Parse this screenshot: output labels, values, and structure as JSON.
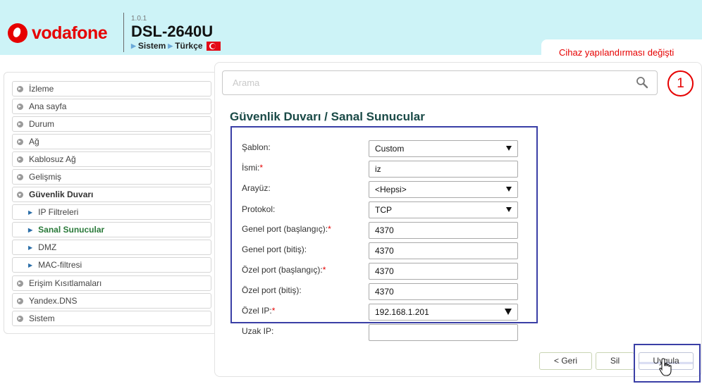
{
  "header": {
    "brand": "vodafone",
    "version": "1.0.1",
    "model": "DSL-2640U",
    "breadcrumb": [
      "Sistem",
      "Türkçe"
    ],
    "notice": "Cihaz yapılandırması değişti"
  },
  "search": {
    "placeholder": "Arama",
    "badge_count": "1"
  },
  "sidebar": {
    "items": [
      {
        "label": "İzleme"
      },
      {
        "label": "Ana sayfa"
      },
      {
        "label": "Durum"
      },
      {
        "label": "Ağ"
      },
      {
        "label": "Kablosuz Ağ"
      },
      {
        "label": "Gelişmiş"
      },
      {
        "label": "Güvenlik Duvarı"
      },
      {
        "label": "IP Filtreleri"
      },
      {
        "label": "Sanal Sunucular"
      },
      {
        "label": "DMZ"
      },
      {
        "label": "MAC-filtresi"
      },
      {
        "label": "Erişim Kısıtlamaları"
      },
      {
        "label": "Yandex.DNS"
      },
      {
        "label": "Sistem"
      }
    ]
  },
  "page": {
    "title": "Güvenlik Duvarı /  Sanal Sunucular"
  },
  "form": {
    "rows": [
      {
        "label": "Şablon:",
        "required": "",
        "value": "Custom"
      },
      {
        "label": "İsmi:",
        "required": "*",
        "value": "iz"
      },
      {
        "label": "Arayüz:",
        "required": "",
        "value": "<Hepsi>"
      },
      {
        "label": "Protokol:",
        "required": "",
        "value": "TCP"
      },
      {
        "label": "Genel port (başlangıç):",
        "required": "*",
        "value": "4370"
      },
      {
        "label": "Genel port (bitiş):",
        "required": "",
        "value": "4370"
      },
      {
        "label": "Özel port (başlangıç):",
        "required": "*",
        "value": "4370"
      },
      {
        "label": "Özel port (bitiş):",
        "required": "",
        "value": "4370"
      },
      {
        "label": "Özel IP:",
        "required": "*",
        "value": "192.168.1.201"
      },
      {
        "label": "Uzak IP:",
        "required": "",
        "value": ""
      }
    ]
  },
  "buttons": {
    "back": "< Geri",
    "delete": "Sil",
    "apply": "Uygula"
  },
  "colors": {
    "brand": "#e60000",
    "header_bg": "#cdf3f7",
    "highlight": "#3a3fa6",
    "title": "#1a4a47"
  }
}
